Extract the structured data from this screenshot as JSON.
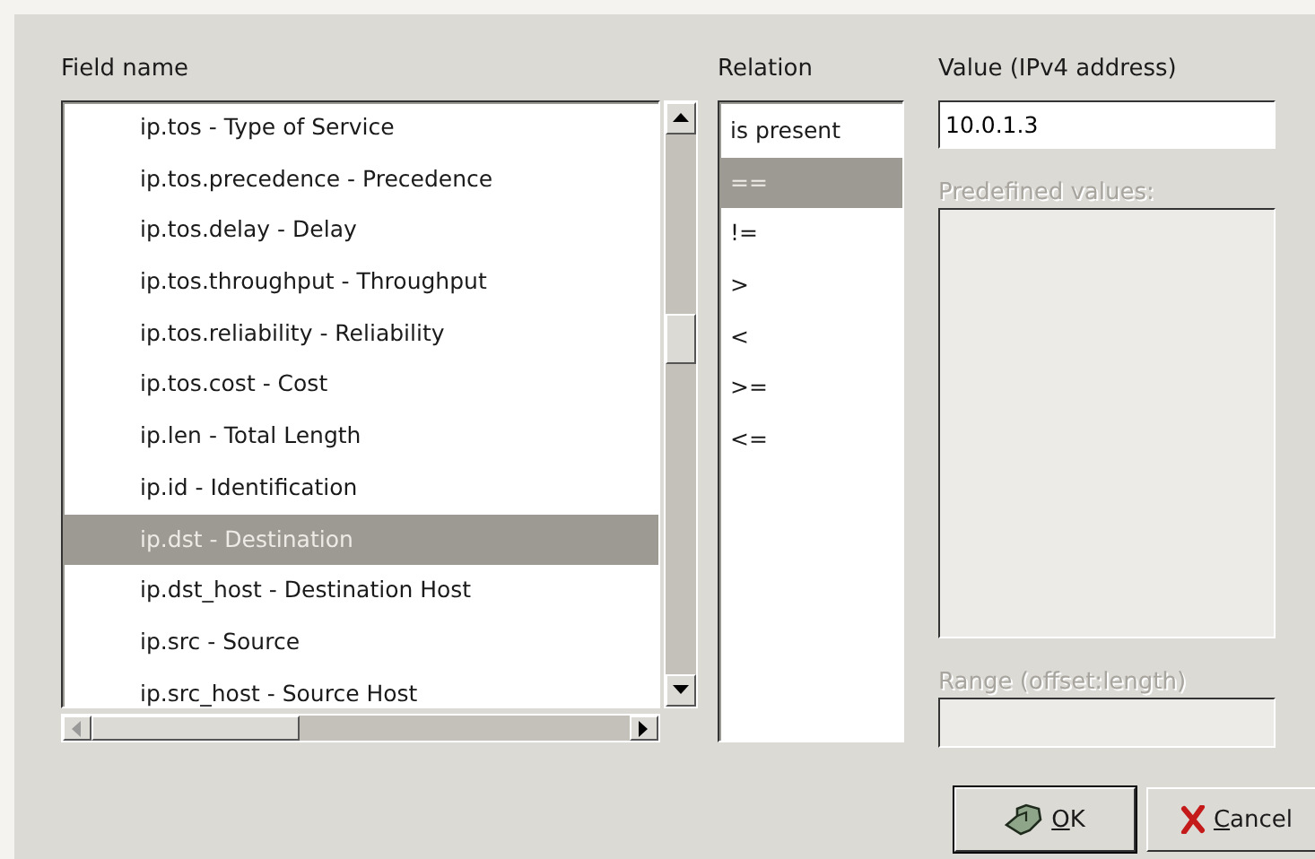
{
  "field_list": {
    "label": "Field name",
    "items": [
      {
        "text": "ip.tos - Type of Service",
        "selected": false
      },
      {
        "text": "ip.tos.precedence - Precedence",
        "selected": false
      },
      {
        "text": "ip.tos.delay - Delay",
        "selected": false
      },
      {
        "text": "ip.tos.throughput - Throughput",
        "selected": false
      },
      {
        "text": "ip.tos.reliability - Reliability",
        "selected": false
      },
      {
        "text": "ip.tos.cost - Cost",
        "selected": false
      },
      {
        "text": "ip.len - Total Length",
        "selected": false
      },
      {
        "text": "ip.id - Identification",
        "selected": false
      },
      {
        "text": "ip.dst - Destination",
        "selected": true
      },
      {
        "text": "ip.dst_host - Destination Host",
        "selected": false
      },
      {
        "text": "ip.src - Source",
        "selected": false
      },
      {
        "text": "ip.src_host - Source Host",
        "selected": false
      }
    ]
  },
  "relation_list": {
    "label": "Relation",
    "items": [
      {
        "text": "is present",
        "selected": false
      },
      {
        "text": "==",
        "selected": true
      },
      {
        "text": "!=",
        "selected": false
      },
      {
        "text": ">",
        "selected": false
      },
      {
        "text": "<",
        "selected": false
      },
      {
        "text": ">=",
        "selected": false
      },
      {
        "text": "<=",
        "selected": false
      }
    ]
  },
  "value": {
    "label": "Value (IPv4 address)",
    "value": "10.0.1.3"
  },
  "predefined": {
    "label": "Predefined values:",
    "disabled": true
  },
  "range": {
    "label": "Range (offset:length)",
    "disabled": true
  },
  "buttons": [
    {
      "label": "OK",
      "kind": "ok"
    },
    {
      "label": "Cancel",
      "kind": "cancel"
    }
  ]
}
